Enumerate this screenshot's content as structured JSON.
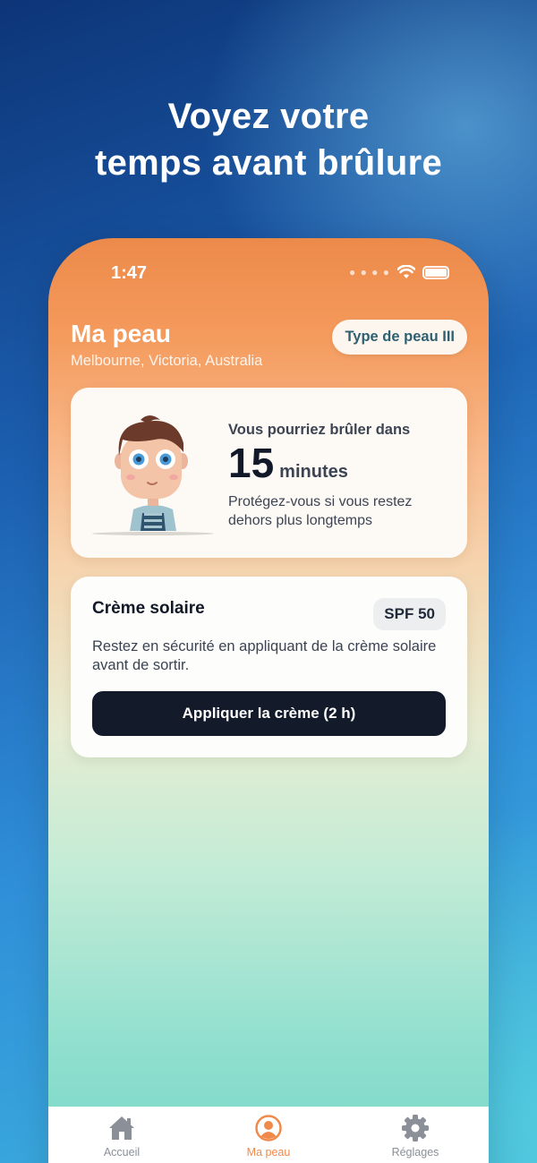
{
  "headline": {
    "line1": "Voyez votre",
    "line2": "temps avant brûlure"
  },
  "status_bar": {
    "time": "1:47",
    "icons": [
      "signal-dots-icon",
      "wifi-icon",
      "battery-icon"
    ]
  },
  "skin": {
    "title": "Ma peau",
    "location": "Melbourne, Victoria, Australia",
    "type_label": "Type de peau III"
  },
  "burn_card": {
    "label": "Vous pourriez brûler dans",
    "value": "15",
    "unit": "minutes",
    "description": "Protégez-vous si vous restez dehors plus longtemps"
  },
  "sunscreen_card": {
    "title": "Crème solaire",
    "spf": "SPF 50",
    "description": "Restez en sécurité en appliquant de la crème solaire avant de sortir.",
    "button_label": "Appliquer la crème (2 h)"
  },
  "tab_bar": {
    "tabs": [
      {
        "label": "Accueil",
        "icon": "home-icon",
        "active": false
      },
      {
        "label": "Ma peau",
        "icon": "profile-icon",
        "active": true
      },
      {
        "label": "Réglages",
        "icon": "gear-icon",
        "active": false
      }
    ]
  },
  "colors": {
    "accent": "#f08a4b",
    "dark_button": "#131a2a",
    "skin_type_text": "#2f6072",
    "inactive_tab": "#8a8f98"
  }
}
